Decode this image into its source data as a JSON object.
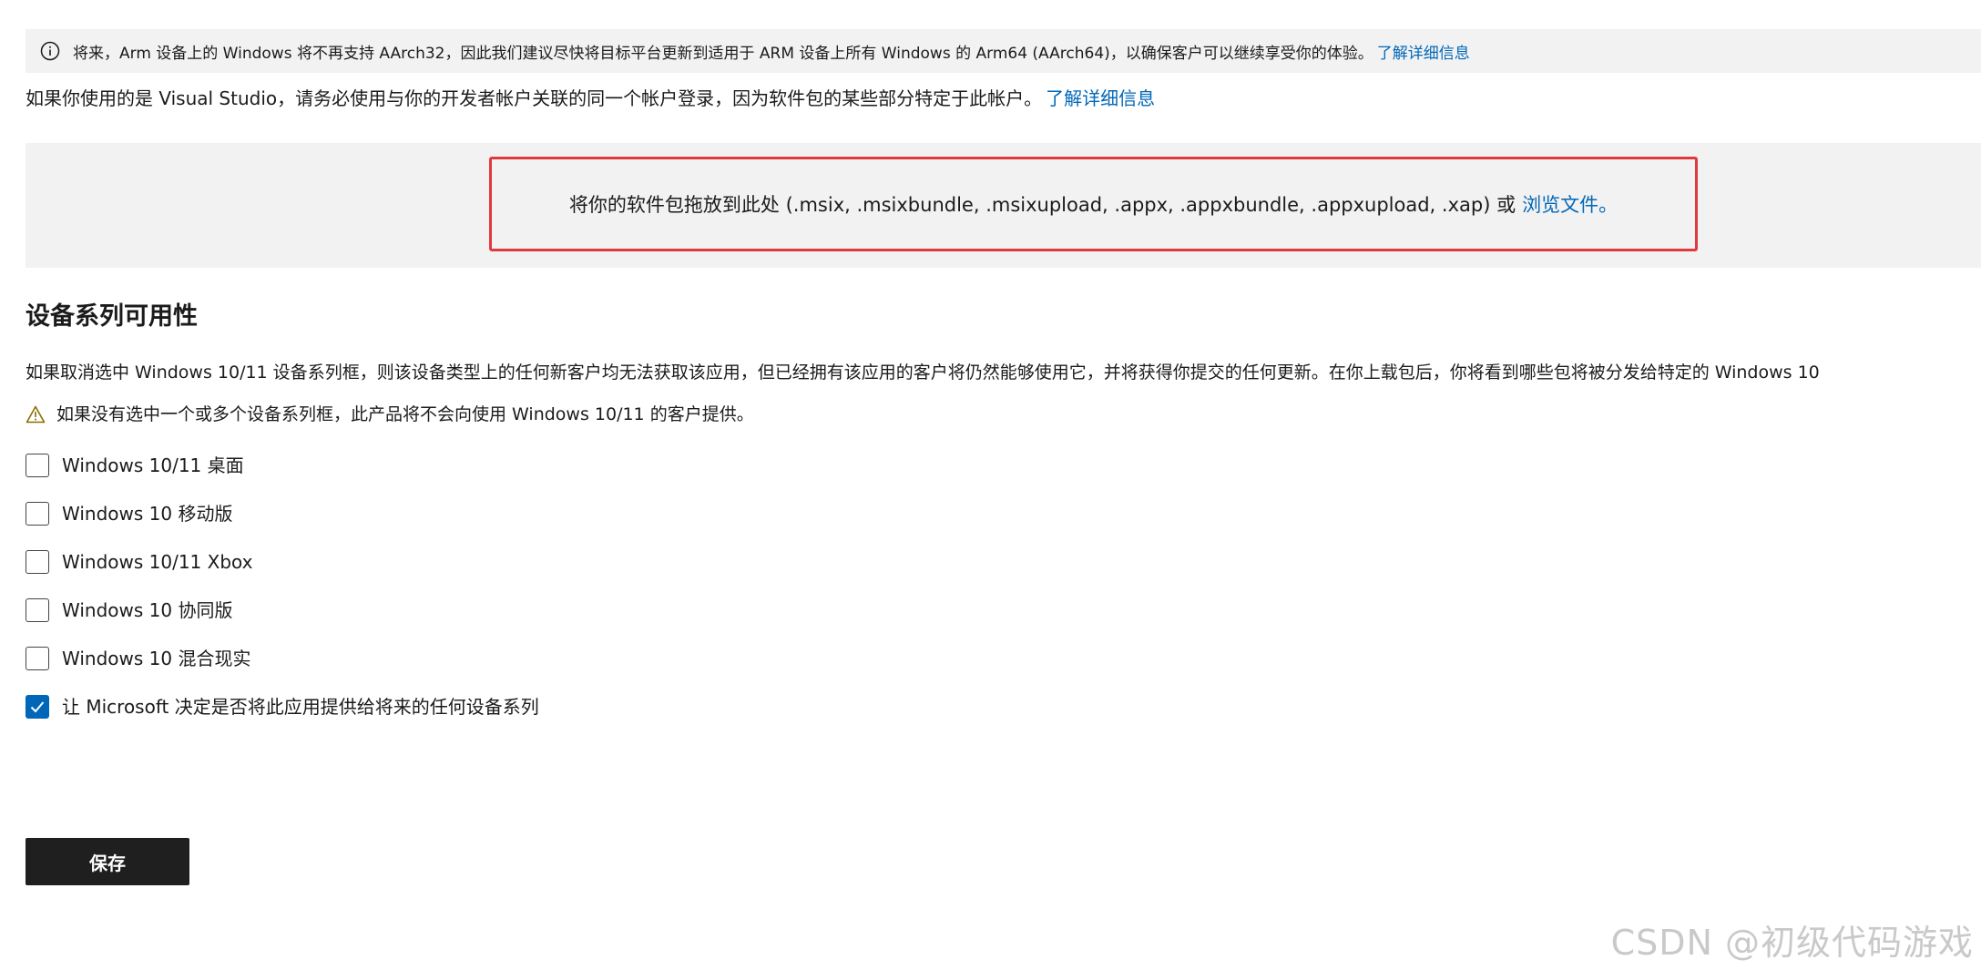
{
  "info_banner": {
    "icon": "info-circle-icon",
    "text": "将来，Arm 设备上的 Windows 将不再支持 AArch32，因此我们建议尽快将目标平台更新到适用于 ARM 设备上所有 Windows 的 Arm64 (AArch64)，以确保客户可以继续享受你的体验。",
    "link_text": "了解详细信息"
  },
  "vs_notice": {
    "text": "如果你使用的是 Visual Studio，请务必使用与你的开发者帐户关联的同一个帐户登录，因为软件包的某些部分特定于此帐户。",
    "link_text": "了解详细信息"
  },
  "upload": {
    "drop_text": "将你的软件包拖放到此处 (.msix, .msixbundle, .msixupload, .appx, .appxbundle, .appxupload, .xap) 或",
    "browse_link": "浏览文件。",
    "highlight_color": "#e0393e"
  },
  "device_families": {
    "title": "设备系列可用性",
    "description": "如果取消选中 Windows 10/11 设备系列框，则该设备类型上的任何新客户均无法获取该应用，但已经拥有该应用的客户将仍然能够使用它，并将获得你提交的任何更新。在你上载包后，你将看到哪些包将被分发给特定的 Windows 10",
    "warning_icon": "warning-triangle-icon",
    "warning": "如果没有选中一个或多个设备系列框，此产品将不会向使用 Windows 10/11 的客户提供。",
    "options": [
      {
        "label": "Windows 10/11 桌面",
        "checked": false
      },
      {
        "label": "Windows 10 移动版",
        "checked": false
      },
      {
        "label": "Windows 10/11 Xbox",
        "checked": false
      },
      {
        "label": "Windows 10 协同版",
        "checked": false
      },
      {
        "label": "Windows 10 混合现实",
        "checked": false
      },
      {
        "label": "让 Microsoft 决定是否将此应用提供给将来的任何设备系列",
        "checked": true
      }
    ]
  },
  "save_button": {
    "label": "保存"
  },
  "watermark": {
    "text": "CSDN @初级代码游戏"
  },
  "colors": {
    "link": "#0067b8",
    "checkbox_checked": "#0067b8",
    "banner_bg": "#f2f2f2",
    "button_bg": "#1f1f1f"
  }
}
